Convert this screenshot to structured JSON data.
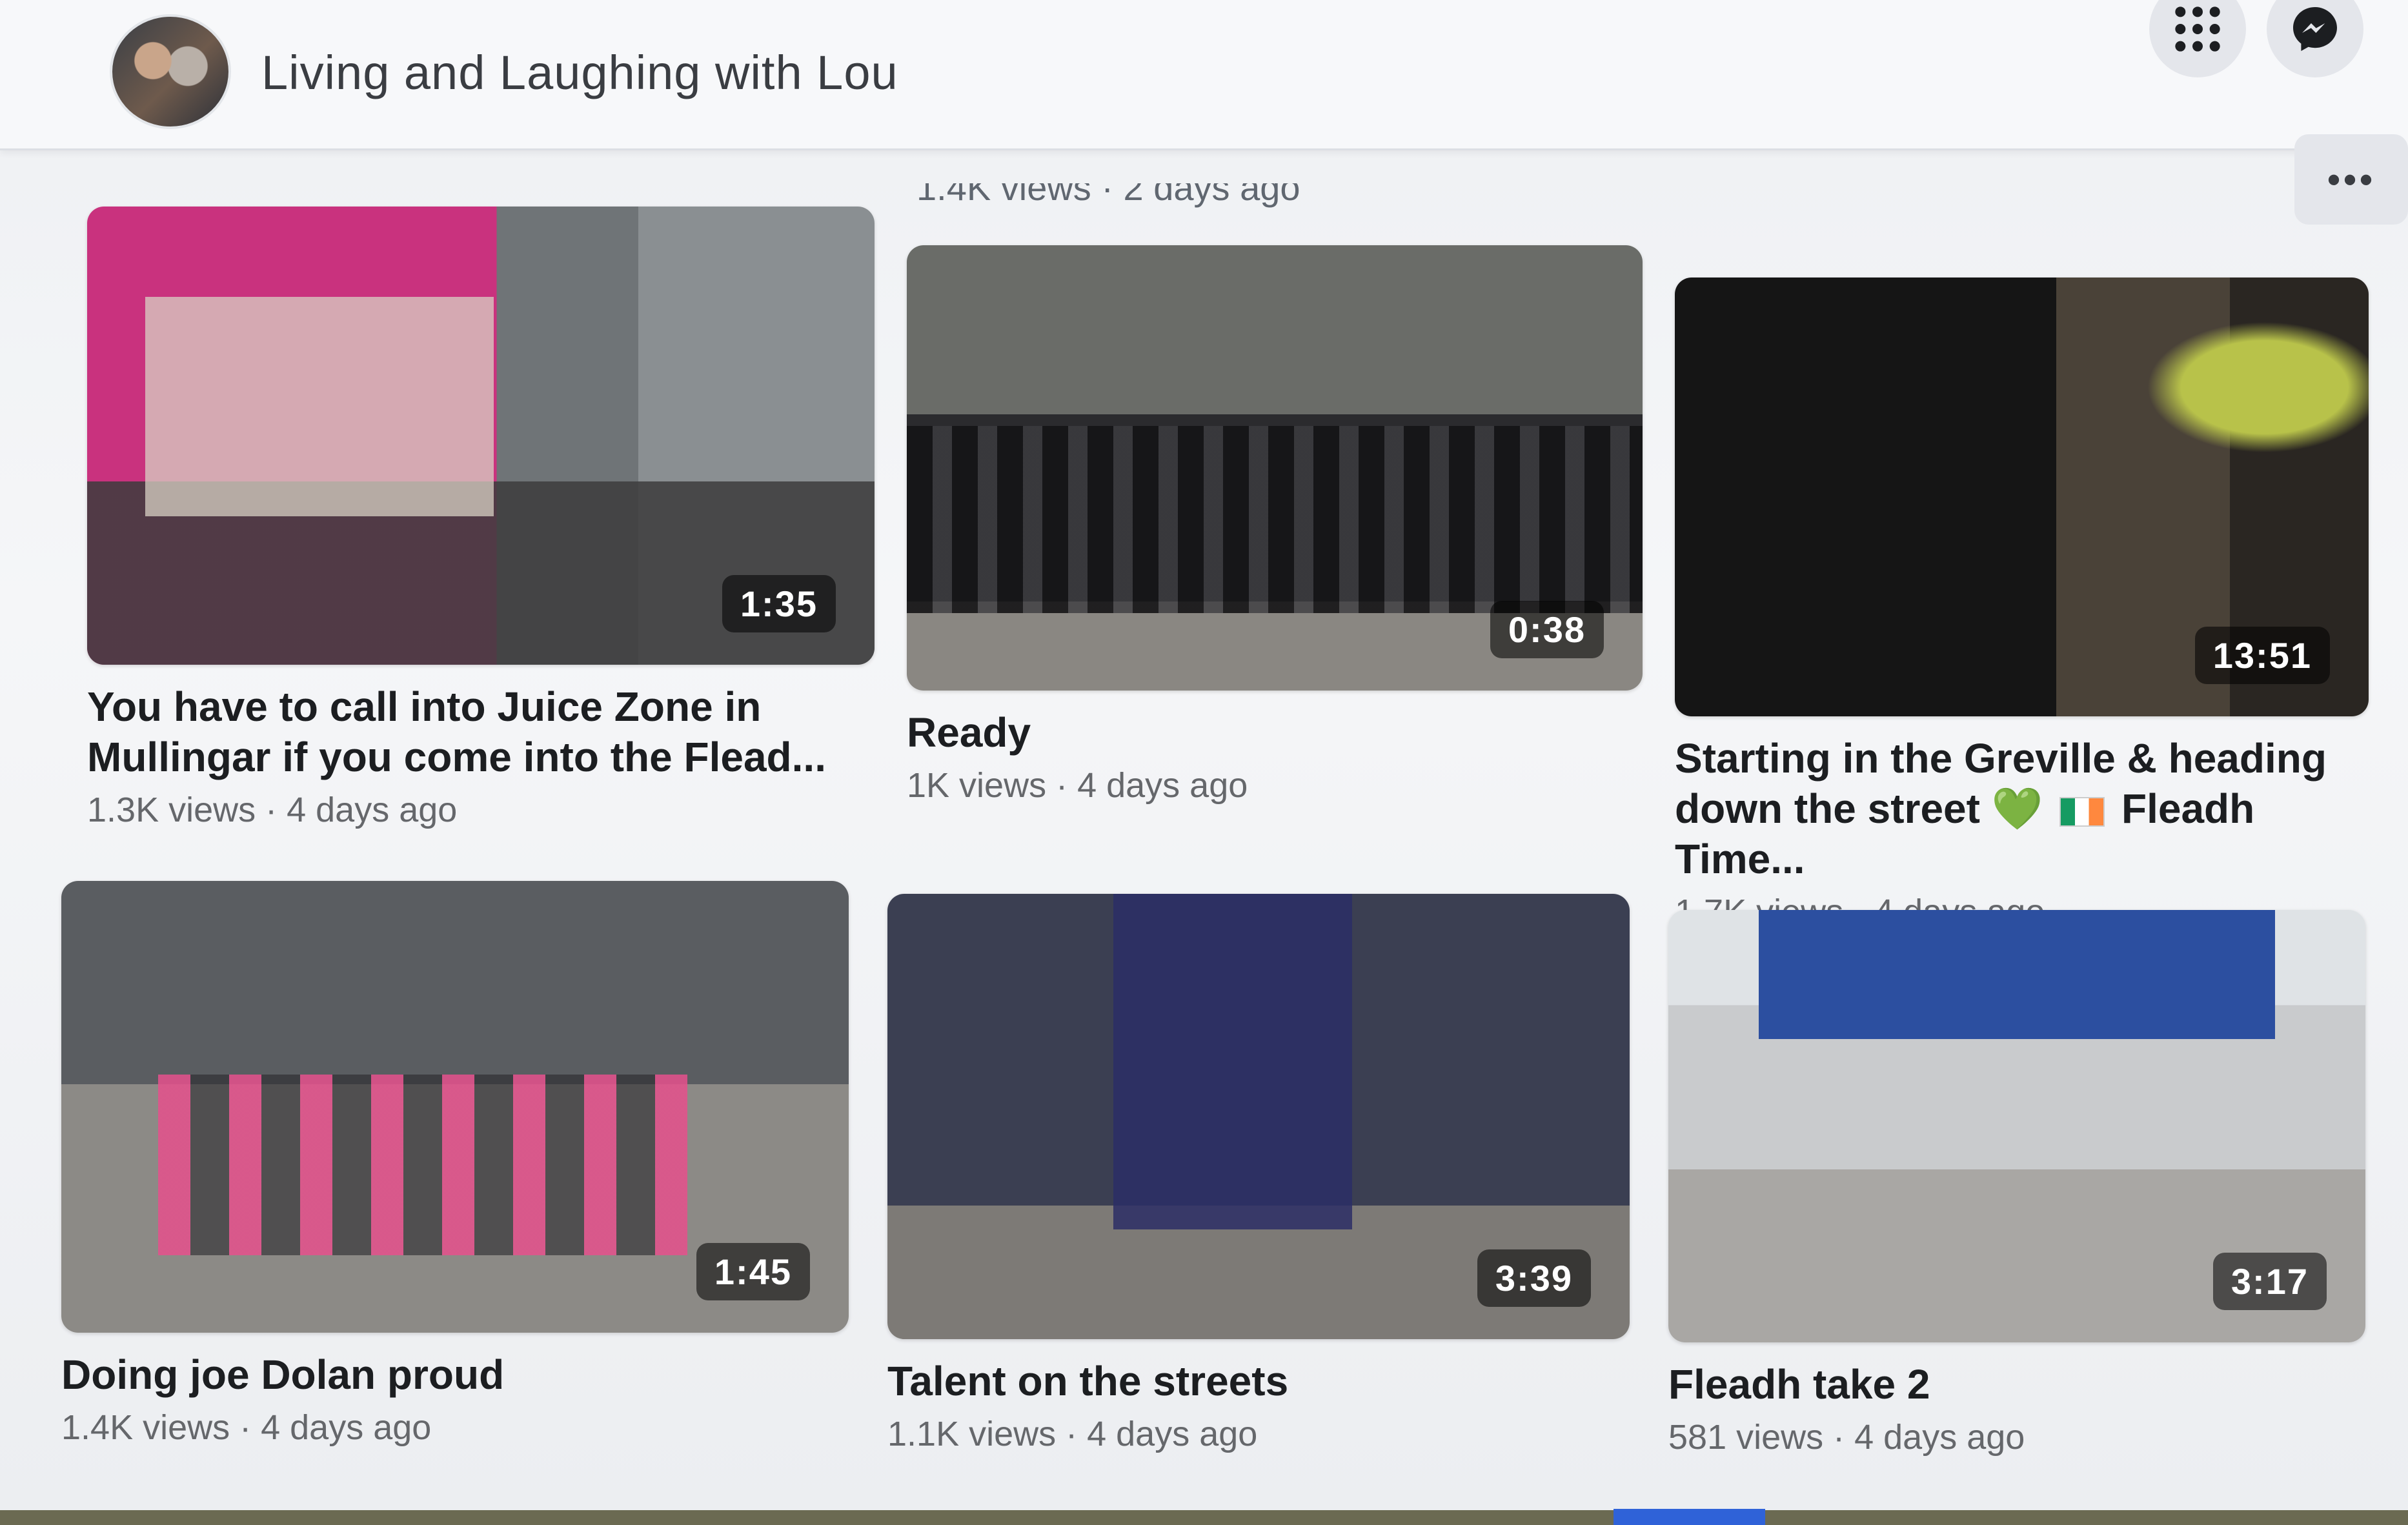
{
  "header": {
    "page_name": "Living and Laughing with Lou",
    "menu_icon": "grid-menu-icon",
    "messenger_icon": "messenger-icon",
    "more_label": "•••"
  },
  "previous_row_meta": "1.4K views · 2 days ago",
  "videos": [
    {
      "title_line1": "You have to call into Juice Zone in",
      "title_line2": "Mullingar if you come into the Flead...",
      "duration": "1:35",
      "meta": "1.3K views · 4 days ago"
    },
    {
      "title_line1": "Ready",
      "title_line2": "",
      "duration": "0:38",
      "meta": "1K views · 4 days ago"
    },
    {
      "title_line1": "Starting in the Greville & heading",
      "title_line2_a": "down the street",
      "title_heart": "💚",
      "title_line2_b": "Fleadh Time...",
      "duration": "13:51",
      "meta": "1.7K views · 4 days ago"
    },
    {
      "title_line1": "Doing joe Dolan proud",
      "duration": "1:45",
      "meta": "1.4K views · 4 days ago"
    },
    {
      "title_line1": "Talent on the streets",
      "duration": "3:39",
      "meta": "1.1K views · 4 days ago"
    },
    {
      "title_line1": "Fleadh take 2",
      "duration": "3:17",
      "meta": "581 views · 4 days ago"
    }
  ]
}
